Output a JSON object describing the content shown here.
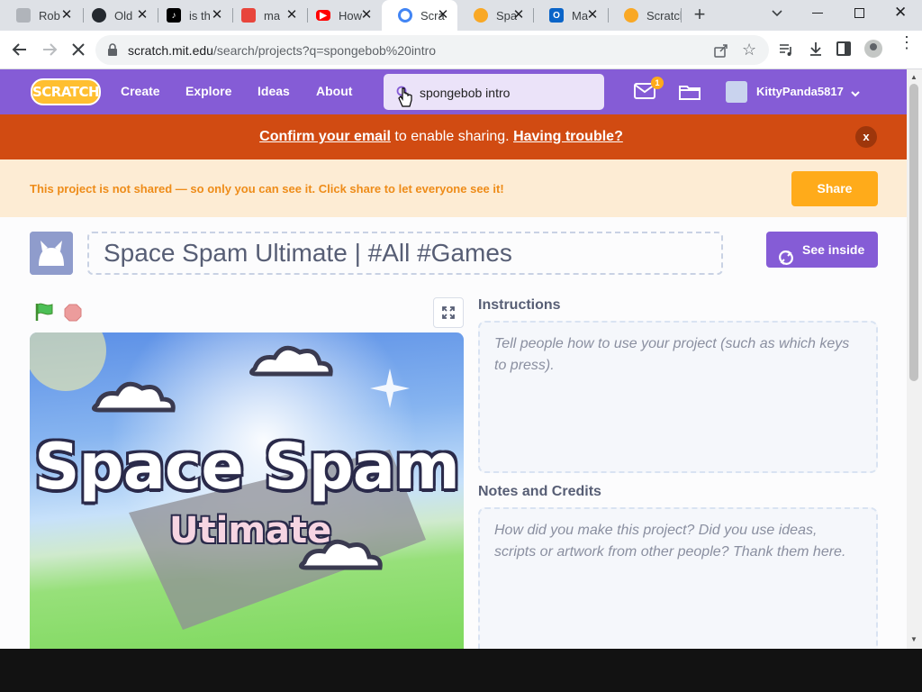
{
  "browser": {
    "tabs": [
      {
        "title": "Rob",
        "icon": "roblox-icon"
      },
      {
        "title": "Old",
        "icon": "github-icon"
      },
      {
        "title": "is th",
        "icon": "tiktok-icon"
      },
      {
        "title": "ma",
        "icon": "bookmark-icon"
      },
      {
        "title": "How",
        "icon": "youtube-icon"
      },
      {
        "title": "Scra",
        "icon": "google-icon",
        "active": true
      },
      {
        "title": "Spa",
        "icon": "scratch-icon"
      },
      {
        "title": "Ma",
        "icon": "outlook-icon"
      },
      {
        "title": "Scratch",
        "icon": "scratch-icon"
      }
    ],
    "url_host": "scratch.mit.edu",
    "url_path": "/search/projects?q=spongebob%20intro"
  },
  "nav": {
    "logo": "SCRATCH",
    "links": [
      "Create",
      "Explore",
      "Ideas",
      "About"
    ],
    "search_value": "spongebob intro",
    "messages_count": "1",
    "username": "KittyPanda5817"
  },
  "banner": {
    "confirm_link": "Confirm your email",
    "middle_text": " to enable sharing. ",
    "trouble_link": "Having trouble?",
    "close": "x"
  },
  "sharebar": {
    "message": "This project is not shared — so only you can see it. Click share to let everyone see it!",
    "share_label": "Share"
  },
  "project": {
    "title": "Space Spam Ultimate | #All #Games",
    "see_inside_label": "See inside",
    "stage_title_line1": "Space Spam",
    "stage_title_line2": "Utimate",
    "instructions_heading": "Instructions",
    "instructions_placeholder": "Tell people how to use your project (such as which keys to press).",
    "notes_heading": "Notes and Credits",
    "notes_placeholder": "How did you make this project? Did you use ideas, scripts or artwork from other people? Thank them here."
  },
  "colors": {
    "scratch_purple": "#855cd6",
    "banner_orange": "#d14b12",
    "share_orange": "#ffab1a"
  }
}
